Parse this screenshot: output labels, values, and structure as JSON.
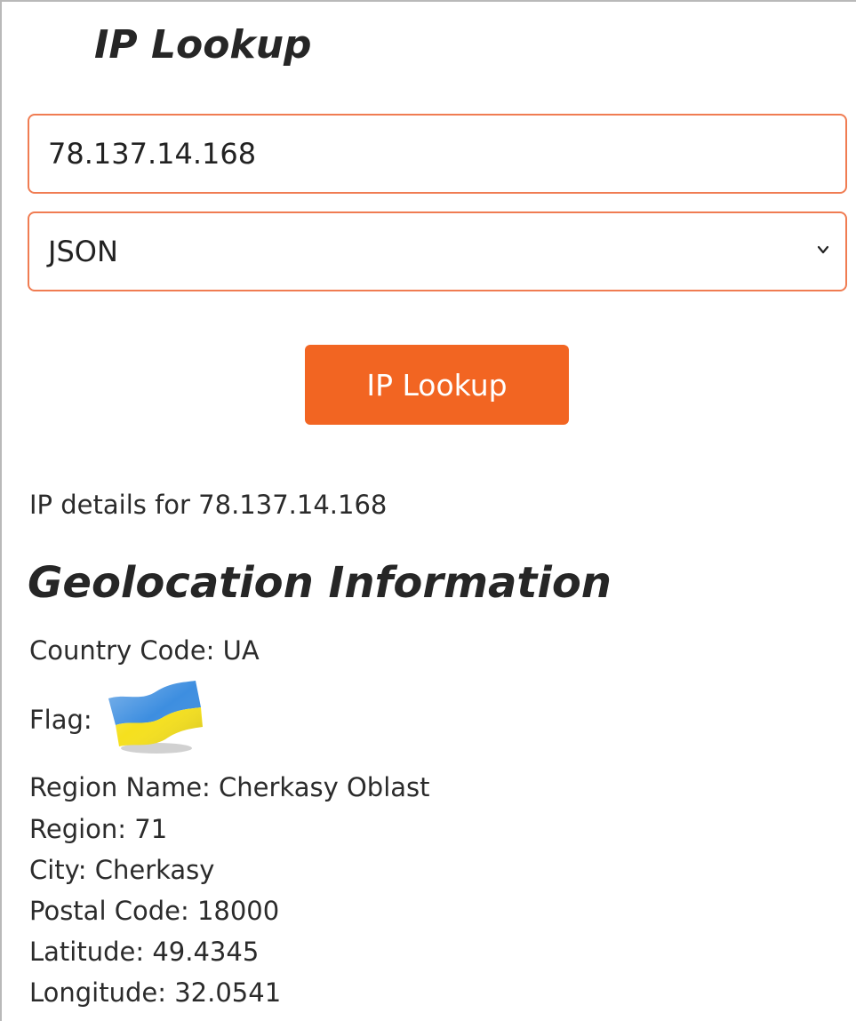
{
  "page": {
    "title": "IP Lookup"
  },
  "form": {
    "ip_value": "78.137.14.168",
    "format_selected": "JSON",
    "submit_label": "IP Lookup"
  },
  "result": {
    "details_line": "IP details for 78.137.14.168",
    "section_heading": "Geolocation Information",
    "country_code": "Country Code: UA",
    "flag_label": "Flag:",
    "flag_icon": "ukraine-flag-icon",
    "flag_colors": {
      "top": "#3d8ee0",
      "bottom": "#f5e01e"
    },
    "region_name": "Region Name: Cherkasy Oblast",
    "region": "Region: 71",
    "city": "City: Cherkasy",
    "postal_code": "Postal Code: 18000",
    "latitude": "Latitude: 49.4345",
    "longitude": "Longitude: 32.0541"
  },
  "colors": {
    "accent": "#f26522",
    "input_border": "#f07c52"
  }
}
